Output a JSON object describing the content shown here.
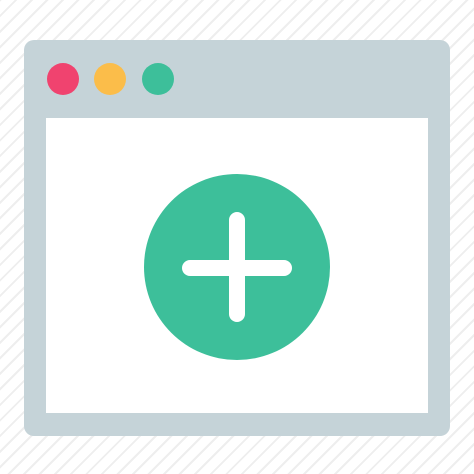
{
  "window": {
    "frame_color": "#c5d3d8",
    "content_color": "#ffffff",
    "controls": [
      {
        "name": "close",
        "color": "#f0436f"
      },
      {
        "name": "minimize",
        "color": "#fbbd4a"
      },
      {
        "name": "zoom",
        "color": "#3dbf9a"
      }
    ]
  },
  "add_button": {
    "icon": "plus-icon",
    "color": "#3dbf9a",
    "icon_color": "#ffffff"
  }
}
